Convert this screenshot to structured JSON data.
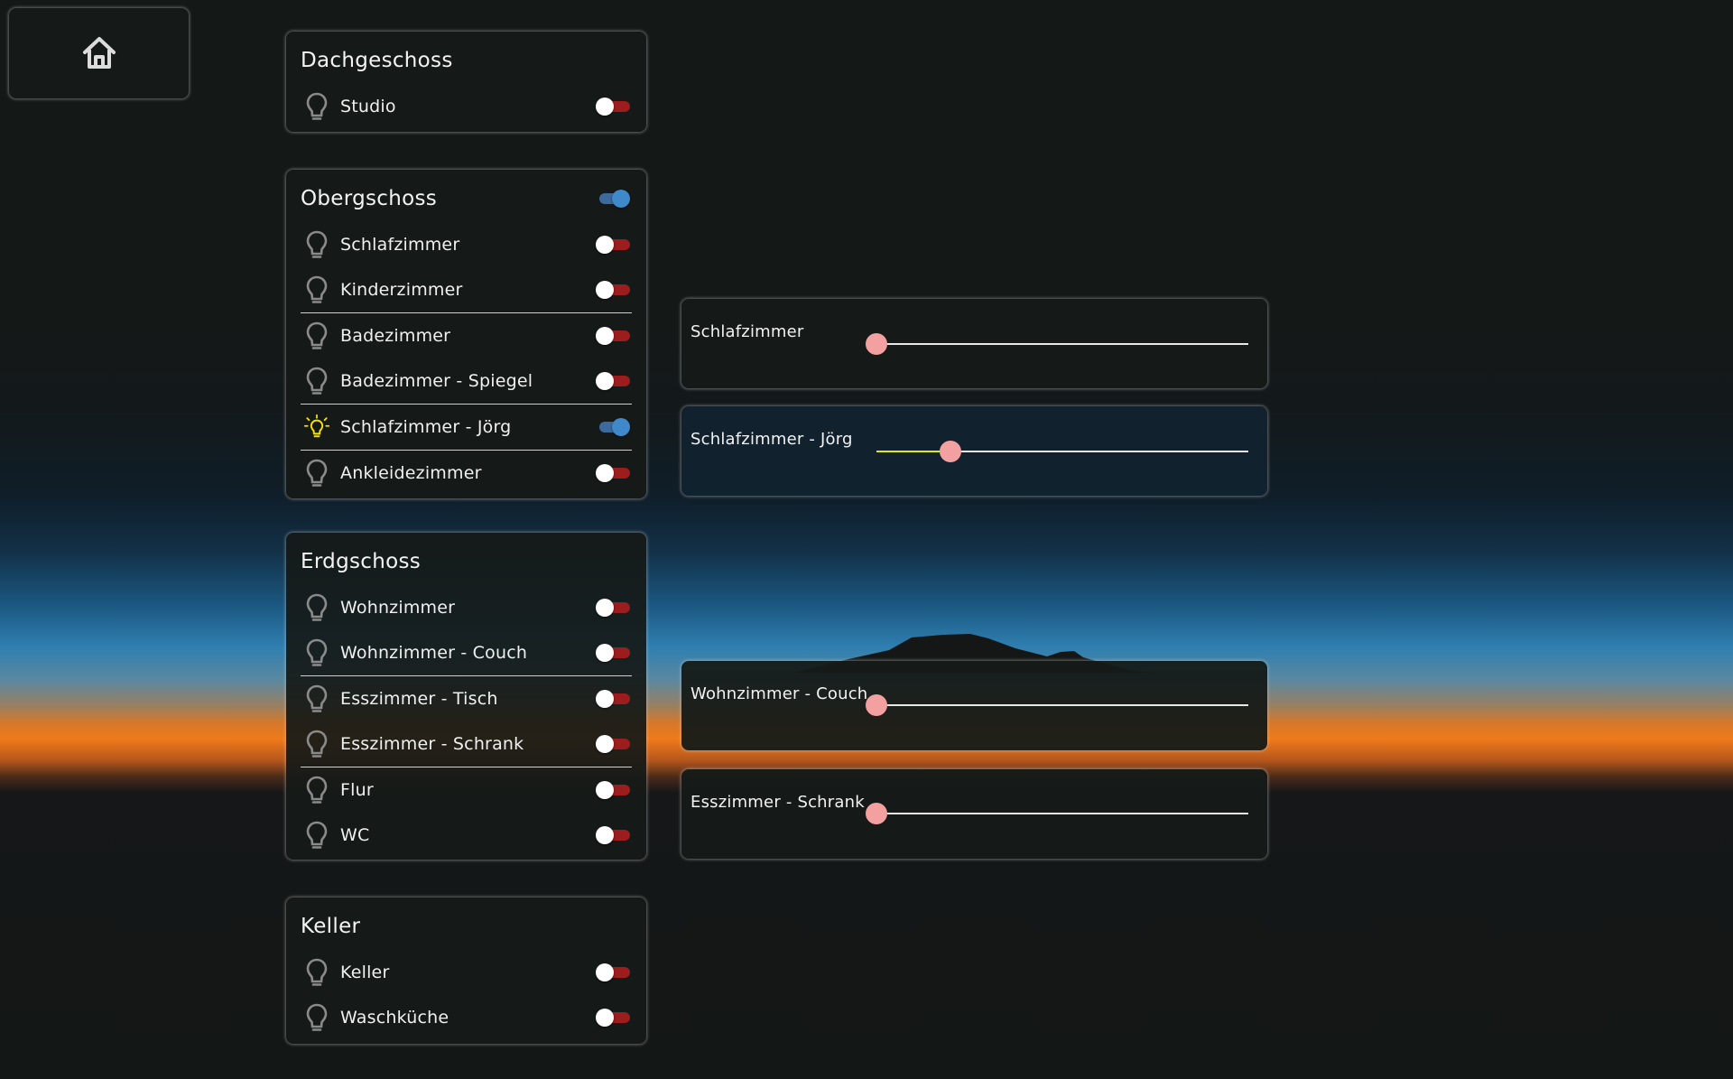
{
  "home": {
    "icon": "home-icon"
  },
  "colors": {
    "toggle_off": "#9c1d1d",
    "toggle_on": "#3f88c9",
    "bulb_on": "#f5e000",
    "slider_thumb": "#f2a0a0"
  },
  "groups": [
    {
      "title": "Dachgeschoss",
      "toggle": null,
      "rooms": [
        {
          "label": "Studio",
          "on": false
        }
      ]
    },
    {
      "title": "Obergschoss",
      "toggle": true,
      "rooms": [
        {
          "label": "Schlafzimmer",
          "on": false
        },
        {
          "label": "Kinderzimmer",
          "on": false
        },
        {
          "label": "Badezimmer",
          "on": false
        },
        {
          "label": "Badezimmer - Spiegel",
          "on": false
        },
        {
          "label": "Schlafzimmer - Jörg",
          "on": true
        },
        {
          "label": "Ankleidezimmer",
          "on": false
        }
      ]
    },
    {
      "title": "Erdgschoss",
      "toggle": null,
      "rooms": [
        {
          "label": "Wohnzimmer",
          "on": false
        },
        {
          "label": "Wohnzimmer - Couch",
          "on": false
        },
        {
          "label": "Esszimmer - Tisch",
          "on": false
        },
        {
          "label": "Esszimmer - Schrank",
          "on": false
        },
        {
          "label": "Flur",
          "on": false
        },
        {
          "label": "WC",
          "on": false
        }
      ]
    },
    {
      "title": "Keller",
      "toggle": null,
      "rooms": [
        {
          "label": "Keller",
          "on": false
        },
        {
          "label": "Waschküche",
          "on": false
        }
      ]
    }
  ],
  "dimmers": [
    {
      "label": "Schlafzimmer",
      "level": 0
    },
    {
      "label": "Schlafzimmer - Jörg",
      "level": 0.2
    },
    {
      "label": "Wohnzimmer - Couch",
      "level": 0
    },
    {
      "label": "Esszimmer - Schrank",
      "level": 0
    }
  ]
}
